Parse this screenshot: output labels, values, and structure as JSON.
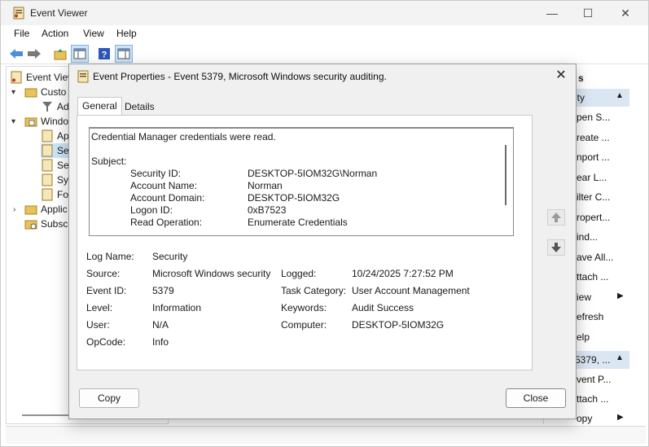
{
  "window": {
    "title": "Event Viewer",
    "minimize_glyph": "—",
    "maximize_glyph": "☐",
    "close_glyph": "✕"
  },
  "menu": [
    "File",
    "Action",
    "View",
    "Help"
  ],
  "toolbar_icons": [
    "back-arrow-icon",
    "forward-arrow-icon",
    "folder-up-icon",
    "show-hide-console-tree-icon",
    "help-icon",
    "show-hide-action-pane-icon"
  ],
  "tree": {
    "root": "Event View",
    "custom_views": "Custo",
    "admin_events": "Ad",
    "windows_logs": "Windo",
    "application": "Ap",
    "security": "Se",
    "setup": "Se",
    "system": "Sys",
    "forwarded": "Fo",
    "apps_services": "Applic",
    "subscriptions": "Subscri"
  },
  "actions": {
    "header": "s",
    "section1_title": "ity",
    "items1": [
      "pen S...",
      "reate ...",
      "nport ...",
      "ear L...",
      "ilter C...",
      "ropert...",
      "ind...",
      "ave All...",
      "ttach ...",
      "iew",
      "efresh",
      "elp"
    ],
    "section2_title": "5379, ...",
    "items2": [
      "vent P...",
      "ttach ...",
      "opy"
    ]
  },
  "dialog": {
    "title": "Event Properties - Event 5379, Microsoft Windows security auditing.",
    "close_glyph": "✕",
    "tabs": [
      "General",
      "Details"
    ],
    "description": {
      "heading": "Credential Manager credentials were read.",
      "subject_label": "Subject:",
      "rows": [
        {
          "label": "Security ID:",
          "value": "DESKTOP-5IOM32G\\Norman"
        },
        {
          "label": "Account Name:",
          "value": "Norman"
        },
        {
          "label": "Account Domain:",
          "value": "DESKTOP-5IOM32G"
        },
        {
          "label": "Logon ID:",
          "value": "0xB7523"
        },
        {
          "label": "Read Operation:",
          "value": "Enumerate Credentials"
        }
      ]
    },
    "fields": {
      "log_name_label": "Log Name:",
      "log_name": "Security",
      "source_label": "Source:",
      "source": "Microsoft Windows security",
      "logged_label": "Logged:",
      "logged": "10/24/2025 7:27:52 PM",
      "event_id_label": "Event ID:",
      "event_id": "5379",
      "task_category_label": "Task Category:",
      "task_category": "User Account Management",
      "level_label": "Level:",
      "level": "Information",
      "keywords_label": "Keywords:",
      "keywords": "Audit Success",
      "user_label": "User:",
      "user": "N/A",
      "computer_label": "Computer:",
      "computer": "DESKTOP-5IOM32G",
      "opcode_label": "OpCode:",
      "opcode": "Info"
    },
    "copy_button": "Copy",
    "close_button": "Close"
  }
}
